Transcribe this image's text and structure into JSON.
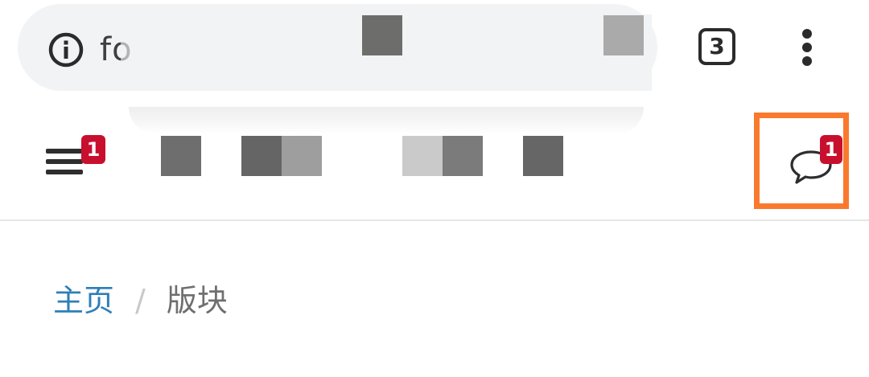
{
  "browser": {
    "url_visible": "fo",
    "tab_count": "3",
    "info_icon": "info-circle-icon",
    "menu_icon": "more-vertical-icon"
  },
  "header": {
    "menu_badge": "1",
    "chat_badge": "1",
    "menu_icon": "hamburger-menu-icon",
    "chat_icon": "chat-bubble-icon",
    "highlight_color": "#f97a2d",
    "badge_color": "#c8102e"
  },
  "breadcrumb": {
    "home": "主页",
    "separator": "/",
    "current": "版块"
  },
  "colors": {
    "link": "#2e7fb8",
    "url_bar": "#f1f3f4"
  }
}
